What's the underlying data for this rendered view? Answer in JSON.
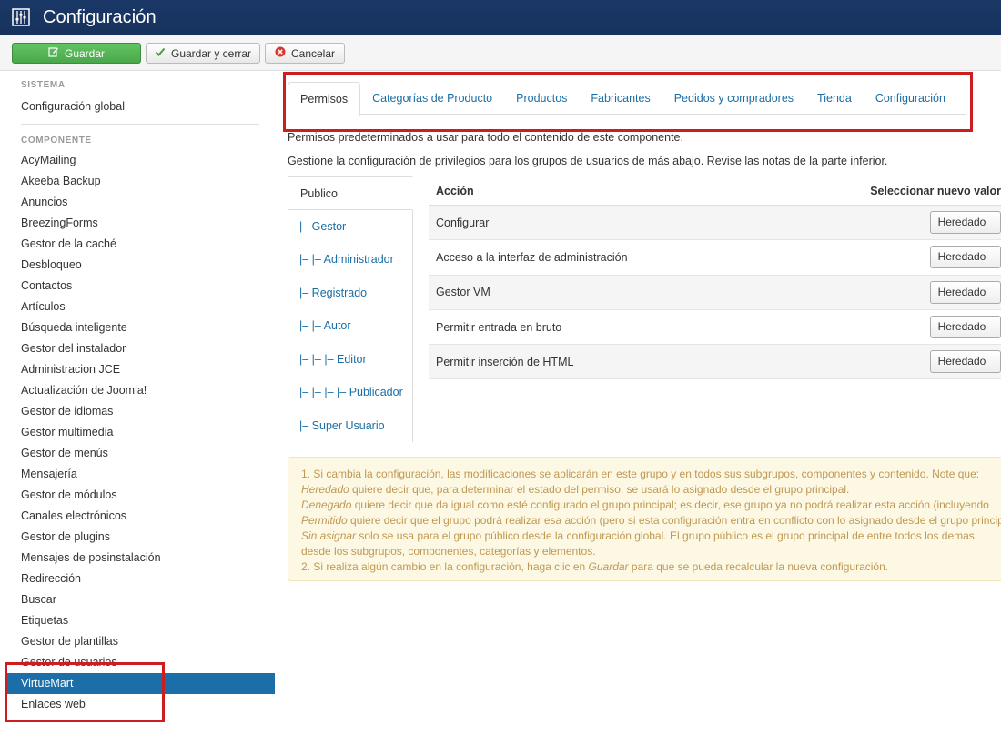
{
  "header": {
    "title": "Configuración",
    "icon": "settings-sliders-icon"
  },
  "toolbar": {
    "save_label": "Guardar",
    "save_close_label": "Guardar y cerrar",
    "cancel_label": "Cancelar"
  },
  "sidebar": {
    "system_heading": "SISTEMA",
    "system_items": [
      "Configuración global"
    ],
    "component_heading": "COMPONENTE",
    "component_items": [
      "AcyMailing",
      "Akeeba Backup",
      "Anuncios",
      "BreezingForms",
      "Gestor de la caché",
      "Desbloqueo",
      "Contactos",
      "Artículos",
      "Búsqueda inteligente",
      "Gestor del instalador",
      "Administracion JCE",
      "Actualización de Joomla!",
      "Gestor de idiomas",
      "Gestor multimedia",
      "Gestor de menús",
      "Mensajería",
      "Gestor de módulos",
      "Canales electrónicos",
      "Gestor de plugins",
      "Mensajes de posinstalación",
      "Redirección",
      "Buscar",
      "Etiquetas",
      "Gestor de plantillas",
      "Gestor de usuarios",
      "VirtueMart",
      "Enlaces web"
    ],
    "active_item": "VirtueMart"
  },
  "tabs": [
    "Permisos",
    "Categorías de Producto",
    "Productos",
    "Fabricantes",
    "Pedidos y compradores",
    "Tienda",
    "Configuración"
  ],
  "description": {
    "line1": "Permisos predeterminados a usar para todo el contenido de este componente.",
    "line2": "Gestione la configuración de privilegios para los grupos de usuarios de más abajo. Revise las notas de la parte inferior."
  },
  "groups": [
    "Publico",
    "|– Gestor",
    "|– |– Administrador",
    "|– Registrado",
    "|– |– Autor",
    "|– |– |– Editor",
    "|– |– |– |– Publicador",
    "|– Super Usuario"
  ],
  "permissions": {
    "col_action": "Acción",
    "col_select": "Seleccionar nuevo valor",
    "rows": [
      {
        "label": "Configurar",
        "value": "Heredado"
      },
      {
        "label": "Acceso a la interfaz de administración",
        "value": "Heredado"
      },
      {
        "label": "Gestor VM",
        "value": "Heredado"
      },
      {
        "label": "Permitir entrada en bruto",
        "value": "Heredado"
      },
      {
        "label": "Permitir inserción de HTML",
        "value": "Heredado"
      }
    ]
  },
  "notes": {
    "l1": "1. Si cambia la configuración, las modificaciones se aplicarán en este grupo y en todos sus subgrupos, componentes y contenido. Note que:",
    "l2_em": "Heredado",
    "l2": " quiere decir que, para determinar el estado del permiso, se usará lo asignado desde el grupo principal.",
    "l3_em": "Denegado",
    "l3": " quiere decir que da igual como esté configurado el grupo principal; es decir, ese grupo ya no podrá realizar esta acción (incluyendo",
    "l4_em": "Permitido",
    "l4": " quiere decir que el grupo podrá realizar esa acción (pero si esta configuración entra en conflicto con lo asignado desde el grupo principal",
    "l5_em": "Sin asignar",
    "l5": " solo se usa para el grupo público desde la configuración global. El grupo público es el grupo principal de entre todos los demas",
    "l6": "desde los subgrupos, componentes, categorías y elementos.",
    "l7a": "2. Si realiza algún cambio en la configuración, haga clic en ",
    "l7_em": "Guardar",
    "l7b": " para que se pueda recalcular la nueva configuración."
  }
}
